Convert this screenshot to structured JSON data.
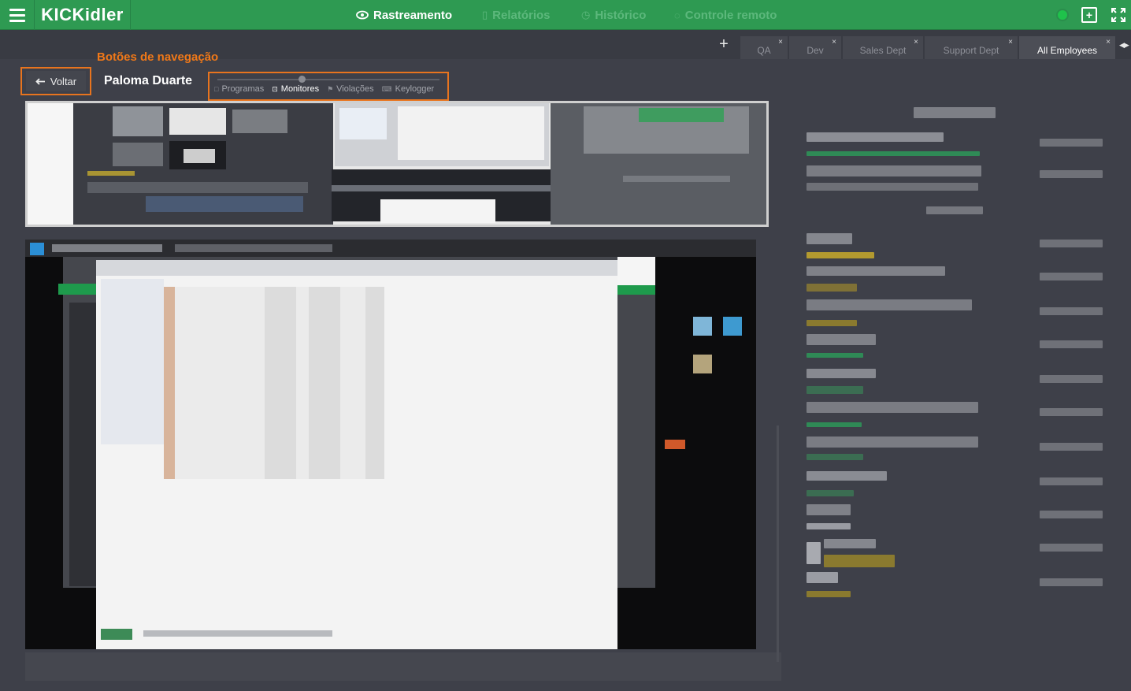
{
  "header": {
    "logo": "KICKidler",
    "nav": [
      {
        "label": "Rastreamento",
        "icon": "eye-icon",
        "active": true
      },
      {
        "label": "Relatórios",
        "icon": "document-icon",
        "active": false
      },
      {
        "label": "Histórico",
        "icon": "history-icon",
        "active": false
      },
      {
        "label": "Controle remoto",
        "icon": "remote-icon",
        "active": false
      }
    ],
    "status_color": "#1fc24b"
  },
  "tabs": {
    "add_label": "+",
    "items": [
      {
        "label": "QA",
        "close": "×"
      },
      {
        "label": "Dev",
        "close": "×"
      },
      {
        "label": "Sales Dept",
        "close": "×"
      },
      {
        "label": "Support Dept",
        "close": "×"
      },
      {
        "label": "All Employees",
        "close": "×",
        "active": true
      }
    ]
  },
  "navigation": {
    "annotation": "Botões de navegação",
    "back_label": "Voltar",
    "employee_name": "Paloma Duarte",
    "view_tabs": [
      {
        "label": "Programas",
        "icon": "square-icon"
      },
      {
        "label": "Monitores",
        "icon": "monitor-icon",
        "active": true
      },
      {
        "label": "Violações",
        "icon": "flag-icon"
      },
      {
        "label": "Keylogger",
        "icon": "keyboard-icon"
      }
    ]
  },
  "colors": {
    "brand_green": "#2e9a52",
    "highlight_orange": "#e8741e",
    "background": "#3e4049"
  }
}
